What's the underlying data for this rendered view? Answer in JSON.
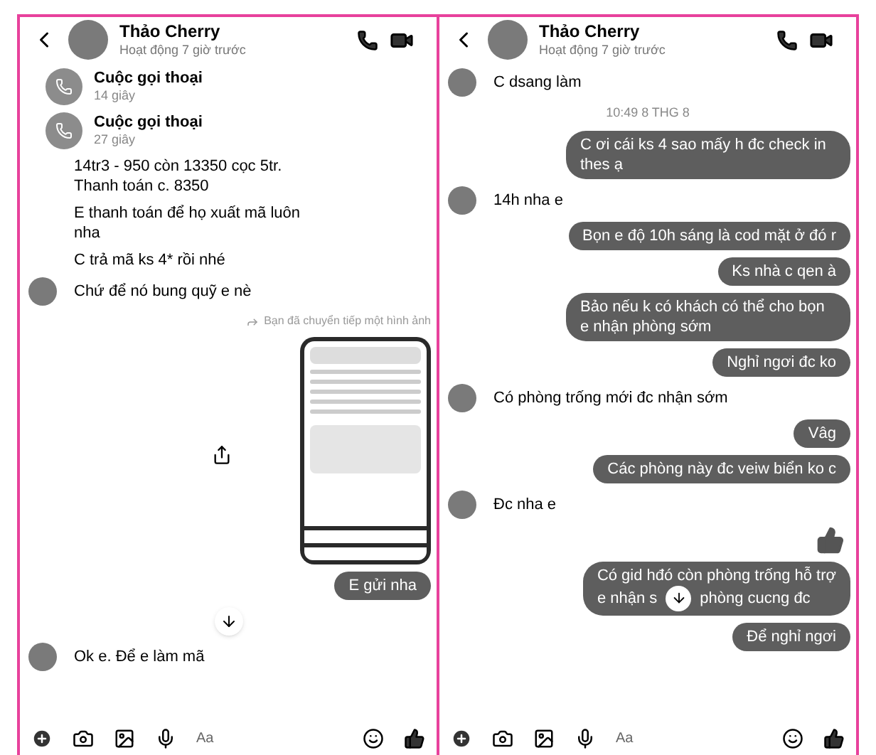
{
  "panels": [
    {
      "header": {
        "name": "Thảo Cherry",
        "status": "Hoạt động 7 giờ trước"
      },
      "messages": [
        {
          "kind": "call",
          "title": "Cuộc gọi thoại",
          "duration": "14 giây"
        },
        {
          "kind": "call",
          "title": "Cuộc gọi thoại",
          "duration": "27 giây"
        },
        {
          "kind": "received",
          "avatar": false,
          "parts": [
            "14tr3 - 950 còn 13350 cọc 5tr. Thanh toán c. 8350"
          ]
        },
        {
          "kind": "received",
          "avatar": false,
          "parts": [
            "E thanh toán để họ xuất mã luôn nha"
          ]
        },
        {
          "kind": "received",
          "avatar": false,
          "parts": [
            "C trả mã ks 4* rồi nhé"
          ]
        },
        {
          "kind": "received",
          "avatar": true,
          "parts": [
            "Chứ để nó bung quỹ e nè"
          ]
        },
        {
          "kind": "forward_note",
          "text": "Bạn đã chuyển tiếp một hình ảnh"
        },
        {
          "kind": "image"
        },
        {
          "kind": "sent",
          "parts": [
            "E gửi nha"
          ]
        },
        {
          "kind": "jump_down"
        },
        {
          "kind": "received",
          "avatar": true,
          "parts": [
            "Ok e. Để e làm mã"
          ]
        }
      ],
      "composer": {
        "placeholder": "Aa"
      }
    },
    {
      "header": {
        "name": "Thảo Cherry",
        "status": "Hoạt động 7 giờ trước"
      },
      "messages": [
        {
          "kind": "received",
          "avatar": true,
          "parts": [
            "C dsang làm"
          ]
        },
        {
          "kind": "timestamp",
          "text": "10:49 8 THG 8"
        },
        {
          "kind": "sent",
          "parts": [
            "C ơi cái ks 4 sao mấy h đc check in thes ạ"
          ]
        },
        {
          "kind": "received",
          "avatar": true,
          "parts": [
            "14h nha e"
          ]
        },
        {
          "kind": "sent",
          "parts": [
            "Bọn e độ 10h sáng là cod mặt ở đó r"
          ]
        },
        {
          "kind": "sent",
          "parts": [
            "Ks nhà c qen à"
          ]
        },
        {
          "kind": "sent",
          "parts": [
            "Bảo nếu k có khách có thể cho bọn e nhận phòng sớm"
          ]
        },
        {
          "kind": "sent",
          "parts": [
            "Nghỉ ngơi đc ko"
          ]
        },
        {
          "kind": "received",
          "avatar": true,
          "parts": [
            "Có phòng trống mới đc nhận sớm"
          ]
        },
        {
          "kind": "sent",
          "parts": [
            "Vâg"
          ]
        },
        {
          "kind": "sent",
          "parts": [
            "Các phòng này đc veiw biển ko c"
          ]
        },
        {
          "kind": "received",
          "avatar": true,
          "parts": [
            "Đc nha e"
          ]
        },
        {
          "kind": "like"
        },
        {
          "kind": "sent",
          "parts": [
            "Có gid hđó còn phòng trống hỗ trợ",
            "e nhận s",
            "phòng cucng đc"
          ]
        },
        {
          "kind": "sent",
          "parts": [
            "Để nghỉ ngơi"
          ]
        }
      ],
      "composer": {
        "placeholder": "Aa"
      }
    }
  ]
}
